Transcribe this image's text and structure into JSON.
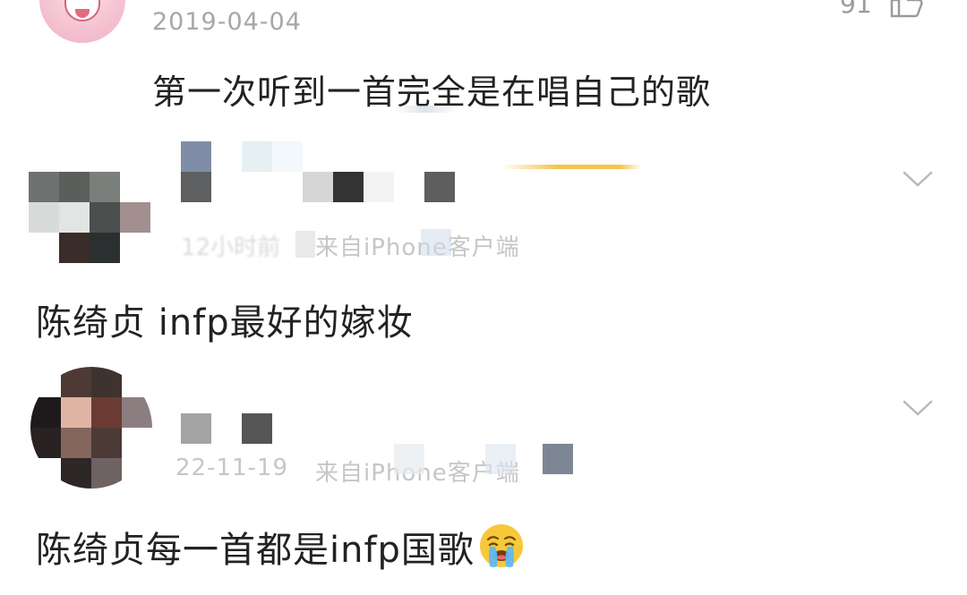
{
  "top_comment": {
    "date": "2019-04-04",
    "like_count": "91",
    "text": "第一次听到一首完全是在唱自己的歌"
  },
  "comments": [
    {
      "meta_left": "12小时前",
      "source": "来自iPhone客户端",
      "text": "陈绮贞 infp最好的嫁妆"
    },
    {
      "meta_left": "22-11-19",
      "source": "来自iPhone客户端",
      "text": "陈绮贞每一首都是infp国歌"
    }
  ],
  "icons": {
    "like": "thumbs-up-icon",
    "expand": "chevron-down-icon",
    "emoji": "loudly-crying-face-emoji"
  }
}
